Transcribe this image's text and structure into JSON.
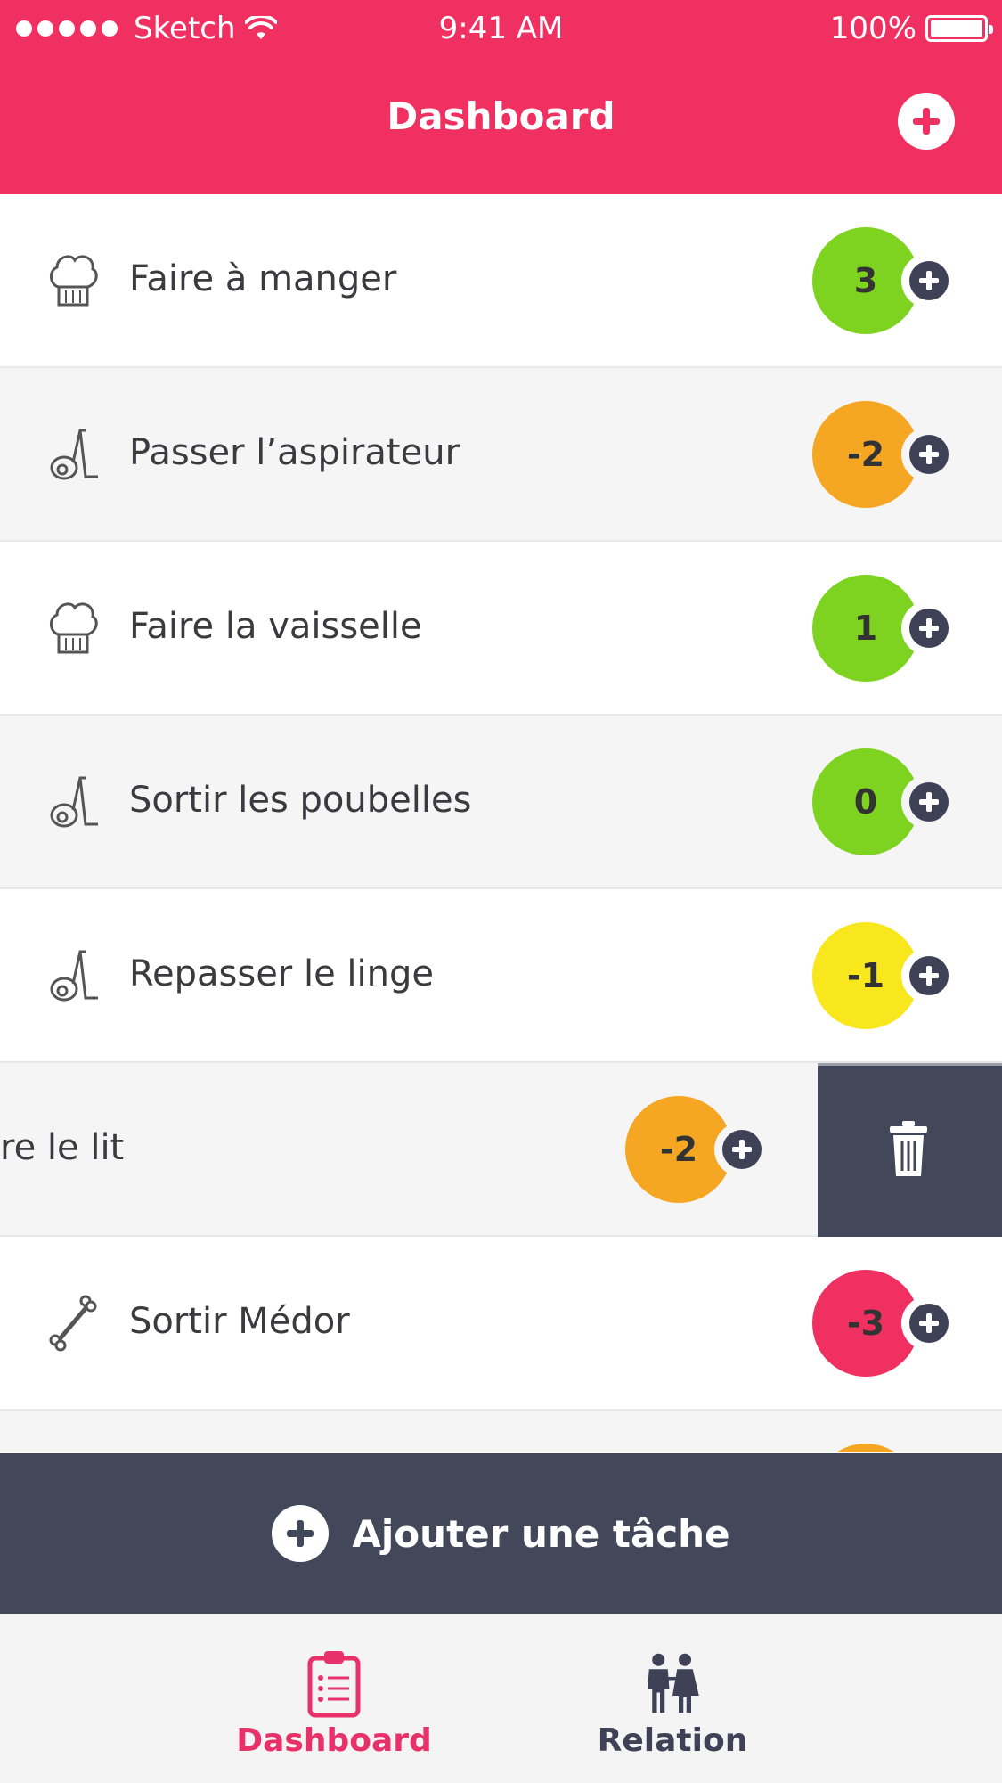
{
  "status_bar": {
    "carrier": "Sketch",
    "time": "9:41 AM",
    "battery": "100%"
  },
  "header": {
    "title": "Dashboard"
  },
  "colors": {
    "accent": "#F03061",
    "dark": "#43475a",
    "green": "#7ED321",
    "orange": "#F5A623",
    "yellow": "#F8E71C",
    "red": "#F03061"
  },
  "tasks": [
    {
      "label": "Faire à manger",
      "score": "3",
      "color": "#7ED321",
      "icon": "chef-hat-icon"
    },
    {
      "label": "Passer l’aspirateur",
      "score": "-2",
      "color": "#F5A623",
      "icon": "vacuum-cleaner-icon"
    },
    {
      "label": "Faire la vaisselle",
      "score": "1",
      "color": "#7ED321",
      "icon": "chef-hat-icon"
    },
    {
      "label": "Sortir les poubelles",
      "score": "0",
      "color": "#7ED321",
      "icon": "vacuum-cleaner-icon"
    },
    {
      "label": "Repasser le linge",
      "score": "-1",
      "color": "#F8E71C",
      "icon": "vacuum-cleaner-icon"
    },
    {
      "label": "re le lit",
      "score": "-2",
      "color": "#F5A623",
      "icon": "none"
    },
    {
      "label": "Sortir Médor",
      "score": "-3",
      "color": "#F03061",
      "icon": "bone-icon"
    },
    {
      "label": "",
      "score": "",
      "color": "#F5A623",
      "icon": "none"
    }
  ],
  "swipe_action": {
    "icon": "trash-icon"
  },
  "add_task": {
    "label": "Ajouter une tâche"
  },
  "tabs": [
    {
      "label": "Dashboard",
      "icon": "clipboard-icon",
      "active": true
    },
    {
      "label": "Relation",
      "icon": "couple-icon",
      "active": false
    }
  ]
}
